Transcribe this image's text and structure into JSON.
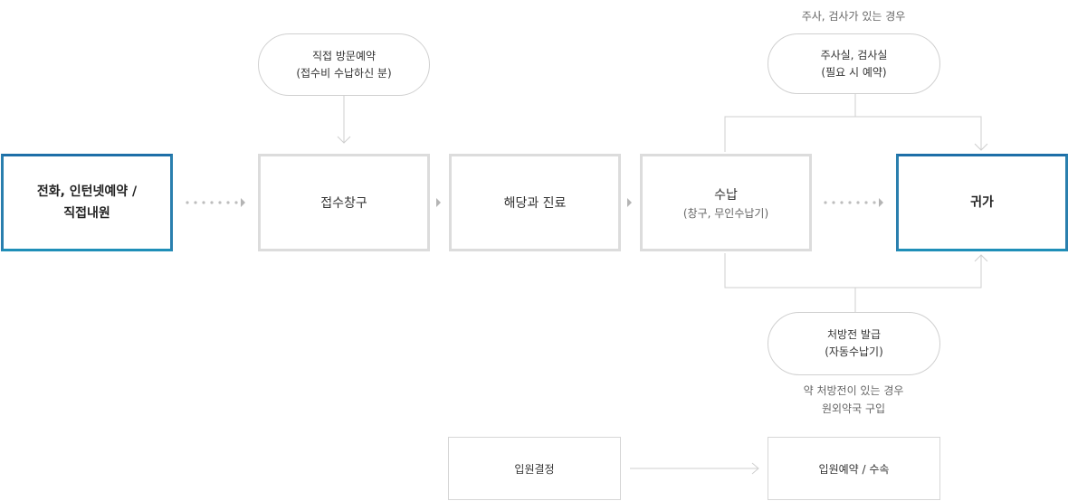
{
  "colors": {
    "accent_blue": "#2a7fae",
    "box_border_gray": "#dcdcdc",
    "connector_gray": "#cfcfcf",
    "arrow_gray": "#b4b4b4",
    "dot_gray": "#bdbdbd"
  },
  "steps": {
    "start": {
      "line1": "전화, 인턴넷예약 /",
      "line2": "직접내원"
    },
    "reception": "접수창구",
    "consult": "해당과 진료",
    "payment": {
      "label": "수납",
      "sub": "(창구, 무인수납기)"
    },
    "home": "귀가"
  },
  "side_nodes": {
    "visit": {
      "line1": "직접 방문예약",
      "line2": "(접수비 수납하신 분)"
    },
    "injection": {
      "line1": "주사실, 검사실",
      "line2": "(필요 시 예약)"
    },
    "prescription": {
      "line1": "처방전 발급",
      "line2": "(자동수납기)"
    }
  },
  "notes": {
    "injection_case": "주사, 검사가 있는 경우",
    "prescription_case_1": "약 처방전이 있는 경우",
    "prescription_case_2": "원외약국 구입"
  },
  "bottom": {
    "admission_decision": "입원결정",
    "admission_booking": "입원예약 / 수속"
  },
  "icons": {
    "dotted_connector": "dotted-arrow-icon",
    "solid_connector": "triangle-arrow-icon",
    "down_arrow": "chevron-down-arrow-icon",
    "up_arrow": "chevron-up-arrow-icon"
  }
}
